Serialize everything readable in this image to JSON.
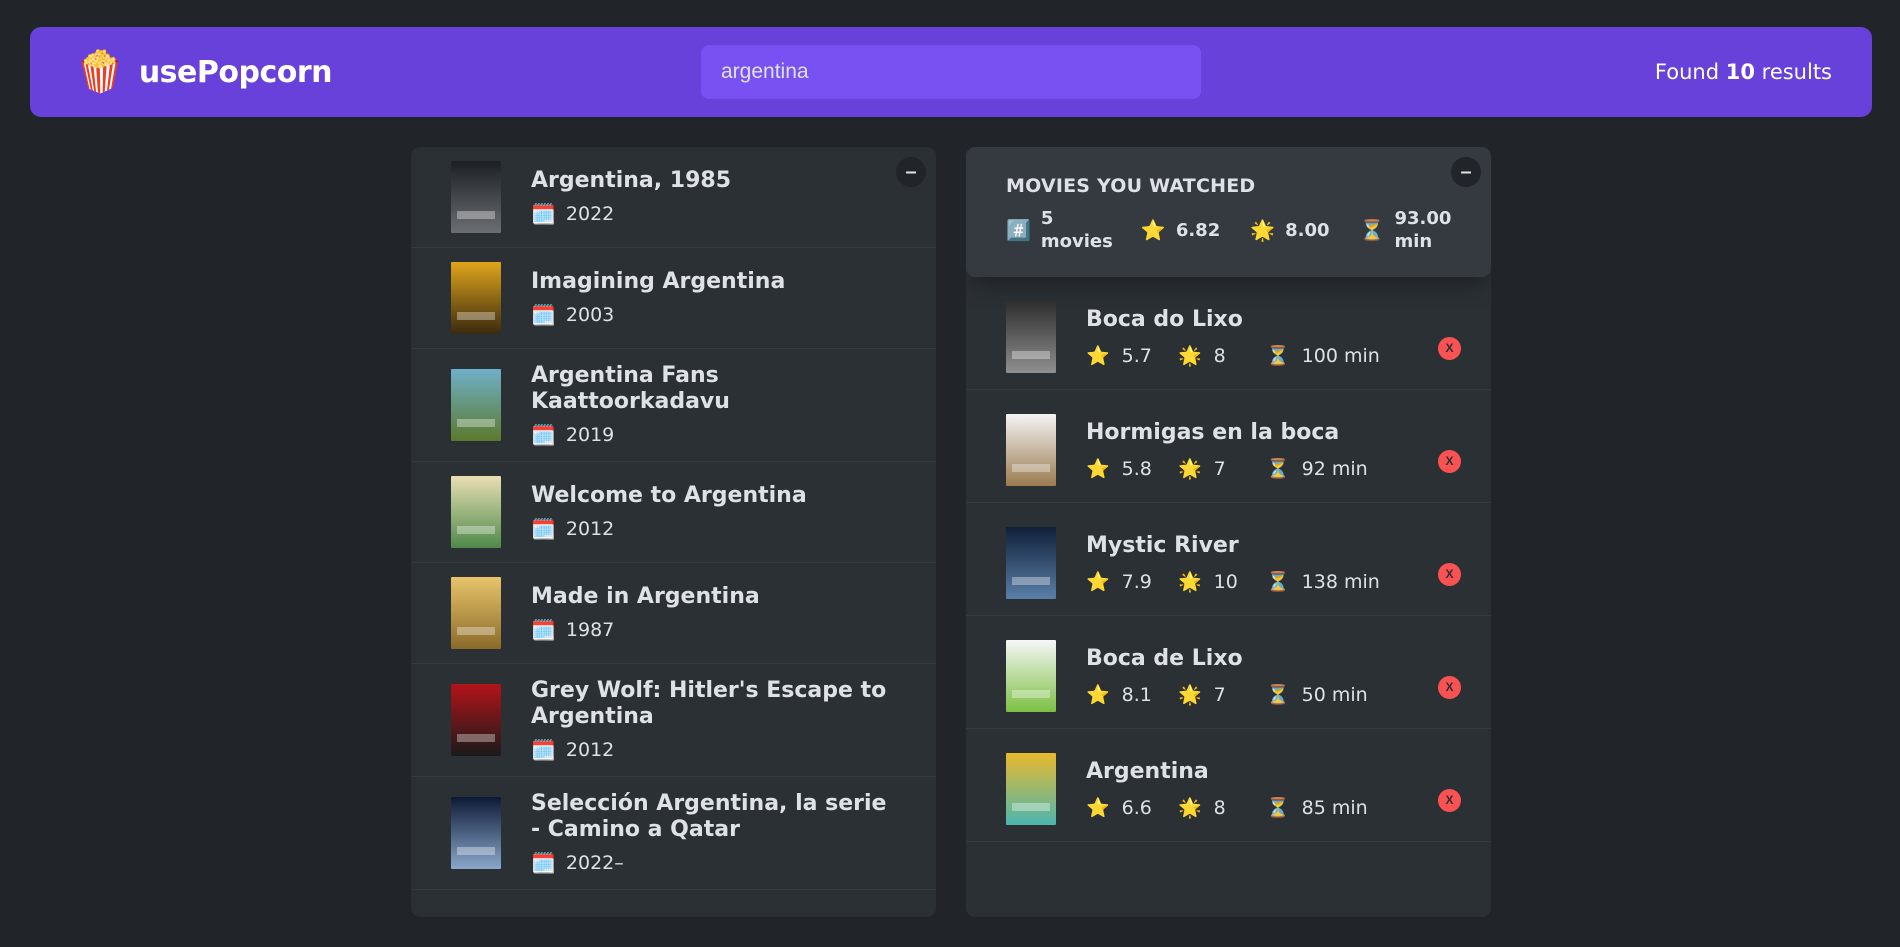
{
  "navbar": {
    "logo_icon": "🍿",
    "logo_text": "usePopcorn",
    "search_value": "argentina",
    "results_prefix": "Found ",
    "results_count": "10",
    "results_suffix": " results"
  },
  "search_results": {
    "toggle_label": "–",
    "movies": [
      {
        "title": "Argentina, 1985",
        "year": "2022",
        "poster_colors": [
          "#1c1f24",
          "#6b6e73"
        ]
      },
      {
        "title": "Imagining Argentina",
        "year": "2003",
        "poster_colors": [
          "#e0a51c",
          "#3a2a0e"
        ]
      },
      {
        "title": "Argentina Fans Kaattoorkadavu",
        "year": "2019",
        "poster_colors": [
          "#6fb0c9",
          "#5b7a2c"
        ]
      },
      {
        "title": "Welcome to Argentina",
        "year": "2012",
        "poster_colors": [
          "#e8dfb4",
          "#4e8a4a"
        ]
      },
      {
        "title": "Made in Argentina",
        "year": "1987",
        "poster_colors": [
          "#e7c46a",
          "#8b6a2a"
        ]
      },
      {
        "title": "Grey Wolf: Hitler's Escape to Argentina",
        "year": "2012",
        "poster_colors": [
          "#b3141a",
          "#1a1a1a"
        ]
      },
      {
        "title": "Selección Argentina, la serie - Camino a Qatar",
        "year": "2022–",
        "poster_colors": [
          "#0d1a36",
          "#8aa8cc"
        ]
      }
    ],
    "calendar_icon": "🗓️"
  },
  "watched": {
    "toggle_label": "–",
    "summary_title": "MOVIES YOU WATCHED",
    "hash_icon": "#️⃣",
    "movies_count": "5",
    "movies_word": "movies",
    "avg_imdb": "6.82",
    "avg_user": "8.00",
    "avg_runtime": "93.00",
    "runtime_unit": "min",
    "star_icon": "⭐",
    "glow_star_icon": "🌟",
    "hourglass_icon": "⏳",
    "delete_label": "X",
    "movies": [
      {
        "title": "Boca do Lixo",
        "imdb": "5.7",
        "user": "8",
        "runtime": "100 min",
        "poster_colors": [
          "#2e2e2e",
          "#8f8f8f"
        ]
      },
      {
        "title": "Hormigas en la boca",
        "imdb": "5.8",
        "user": "7",
        "runtime": "92 min",
        "poster_colors": [
          "#f4f4f4",
          "#9a7b4f"
        ]
      },
      {
        "title": "Mystic River",
        "imdb": "7.9",
        "user": "10",
        "runtime": "138 min",
        "poster_colors": [
          "#10203a",
          "#5a7fa8"
        ]
      },
      {
        "title": "Boca de Lixo",
        "imdb": "8.1",
        "user": "7",
        "runtime": "50 min",
        "poster_colors": [
          "#f7f7f7",
          "#7cc043"
        ]
      },
      {
        "title": "Argentina",
        "imdb": "6.6",
        "user": "8",
        "runtime": "85 min",
        "poster_colors": [
          "#e9b92b",
          "#4bb6b0"
        ]
      }
    ]
  }
}
